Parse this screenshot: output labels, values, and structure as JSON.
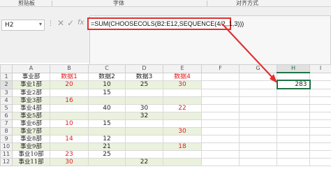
{
  "ribbon": {
    "groups": [
      "剪贴板",
      "字体",
      "对齐方式"
    ]
  },
  "formula_bar": {
    "name_box": "H2",
    "cancel_glyph": "✕",
    "enter_glyph": "✓",
    "fx_glyph": "fx",
    "formula": "=SUM(CHOOSECOLS(B2:E12,SEQUENCE(4/2,,1,3)))"
  },
  "sheet": {
    "columns": [
      "A",
      "B",
      "C",
      "D",
      "E",
      "F",
      "G",
      "H",
      "I"
    ],
    "rows": [
      {
        "num": "1",
        "cells": [
          "事业部",
          "数据1",
          "数据2",
          "数据3",
          "数据4",
          "",
          "",
          "",
          ""
        ]
      },
      {
        "num": "2",
        "cells": [
          "事业1部",
          "20",
          "10",
          "25",
          "30",
          "",
          "",
          "283",
          ""
        ]
      },
      {
        "num": "3",
        "cells": [
          "事业2部",
          "",
          "15",
          "",
          "",
          "",
          "",
          "",
          ""
        ]
      },
      {
        "num": "4",
        "cells": [
          "事业3部",
          "16",
          "",
          "",
          "",
          "",
          "",
          "",
          ""
        ]
      },
      {
        "num": "5",
        "cells": [
          "事业4部",
          "",
          "40",
          "30",
          "22",
          "",
          "",
          "",
          ""
        ]
      },
      {
        "num": "6",
        "cells": [
          "事业5部",
          "",
          "",
          "32",
          "",
          "",
          "",
          "",
          ""
        ]
      },
      {
        "num": "7",
        "cells": [
          "事业6部",
          "10",
          "15",
          "",
          "",
          "",
          "",
          "",
          ""
        ]
      },
      {
        "num": "8",
        "cells": [
          "事业7部",
          "",
          "",
          "",
          "30",
          "",
          "",
          "",
          ""
        ]
      },
      {
        "num": "9",
        "cells": [
          "事业8部",
          "14",
          "12",
          "",
          "",
          "",
          "",
          "",
          ""
        ]
      },
      {
        "num": "10",
        "cells": [
          "事业9部",
          "",
          "21",
          "",
          "18",
          "",
          "",
          "",
          ""
        ]
      },
      {
        "num": "11",
        "cells": [
          "事业10部",
          "23",
          "25",
          "",
          "",
          "",
          "",
          "",
          ""
        ]
      },
      {
        "num": "12",
        "cells": [
          "事业11部",
          "30",
          "",
          "22",
          "",
          "",
          "",
          "",
          ""
        ]
      }
    ]
  },
  "colors": {
    "accent_red": "#e02020",
    "excel_green": "#217346",
    "band_fill": "#eaf1dd"
  }
}
